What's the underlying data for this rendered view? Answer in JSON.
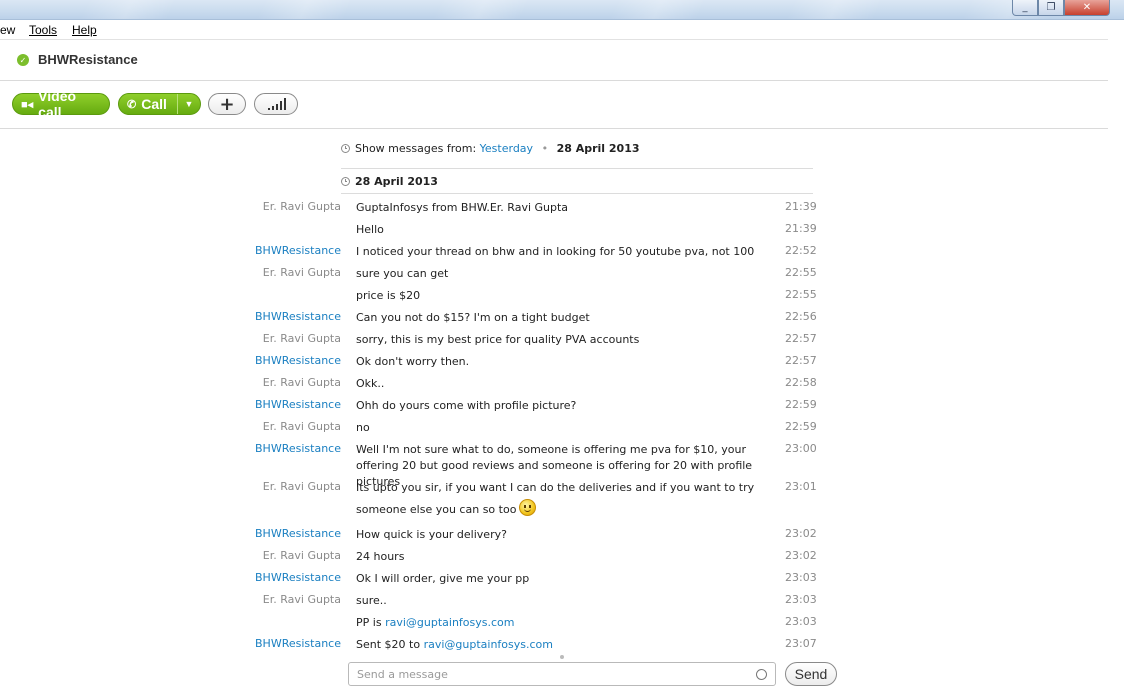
{
  "window": {
    "min": "_",
    "max": "❐",
    "close": "✕"
  },
  "menu": {
    "view_partial": "ew",
    "tools": "Tools",
    "help": "Help"
  },
  "contact": {
    "name": "BHWResistance",
    "status_color": "#7cbe2c"
  },
  "toolbar": {
    "video_call": "Video call",
    "call": "Call",
    "add": "+",
    "signal_icon": "signal-bars-icon",
    "accent": "#6cb31a"
  },
  "history": {
    "show_from_label": "Show messages from:",
    "yesterday": "Yesterday",
    "dot": "•",
    "date": "28 April 2013"
  },
  "date_header": "28 April 2013",
  "messages": [
    {
      "sender": "Er. Ravi Gupta",
      "text": "GuptaInfosys from BHW.Er. Ravi Gupta",
      "time": "21:39"
    },
    {
      "sender": "",
      "text": "Hello",
      "time": "21:39"
    },
    {
      "sender": "BHWResistance",
      "text": "I noticed your thread on bhw and in looking for 50 youtube pva, not 100",
      "time": "22:52"
    },
    {
      "sender": "Er. Ravi Gupta",
      "text": "sure you can get",
      "time": "22:55"
    },
    {
      "sender": "",
      "text": "price is $20",
      "time": "22:55"
    },
    {
      "sender": "BHWResistance",
      "text": "Can you not do $15? I'm on a tight budget",
      "time": "22:56"
    },
    {
      "sender": "Er. Ravi Gupta",
      "text": "sorry, this is my best price for quality PVA accounts",
      "time": "22:57"
    },
    {
      "sender": "BHWResistance",
      "text": "Ok don't worry then.",
      "time": "22:57"
    },
    {
      "sender": "Er. Ravi Gupta",
      "text": "Okk..",
      "time": "22:58"
    },
    {
      "sender": "BHWResistance",
      "text": "Ohh do yours come with profile picture?",
      "time": "22:59"
    },
    {
      "sender": "Er. Ravi Gupta",
      "text": "no",
      "time": "22:59"
    },
    {
      "sender": "BHWResistance",
      "text": "Well I'm not sure what to do, someone is offering me pva for $10, your offering 20 but good reviews and someone is offering for 20 with profile pictures",
      "time": "23:00"
    },
    {
      "sender": "Er. Ravi Gupta",
      "text": "Its upto you sir, if you want I can do the deliveries and if you want to try someone else you can so too",
      "time": "23:01",
      "emoticon": "smile-emoticon"
    },
    {
      "sender": "BHWResistance",
      "text": "How quick is your delivery?",
      "time": "23:02"
    },
    {
      "sender": "Er. Ravi Gupta",
      "text": "24 hours",
      "time": "23:02"
    },
    {
      "sender": "BHWResistance",
      "text": "Ok I will order, give me your pp",
      "time": "23:03"
    },
    {
      "sender": "Er. Ravi Gupta",
      "text": "sure..",
      "time": "23:03"
    },
    {
      "sender": "",
      "text_prefix": "PP is",
      "link": "ravi@guptainfosys.com",
      "time": "23:03"
    },
    {
      "sender": "BHWResistance",
      "text_prefix": "Sent $20 to",
      "link": "ravi@guptainfosys.com",
      "time": "23:07"
    }
  ],
  "composer": {
    "placeholder": "Send a message",
    "send": "Send"
  }
}
